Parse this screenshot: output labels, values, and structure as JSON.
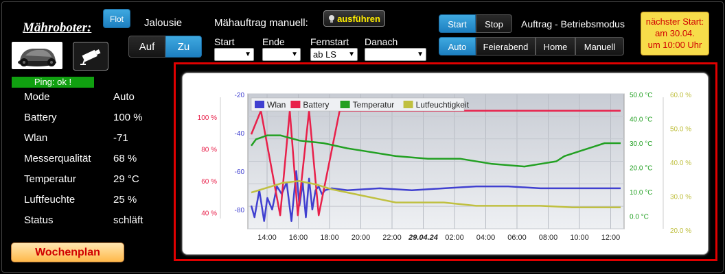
{
  "app": {
    "title": "Mähroboter:",
    "ping": "Ping: ok !",
    "wochenplan": "Wochenplan"
  },
  "status": [
    {
      "key": "Mode",
      "value": "Auto"
    },
    {
      "key": "Battery",
      "value": "100 %"
    },
    {
      "key": "Wlan",
      "value": "-71"
    },
    {
      "key": "Messerqualität",
      "value": "68 %"
    },
    {
      "key": "Temperatur",
      "value": "29 °C"
    },
    {
      "key": "Luftfeuchte",
      "value": "25 %"
    },
    {
      "key": "Status",
      "value": "schläft"
    }
  ],
  "jalousie": {
    "flot": "Flot",
    "label": "Jalousie",
    "auf": "Auf",
    "zu": "Zu"
  },
  "manual": {
    "label": "Mähauftrag manuell:",
    "execute": "ausführen",
    "fields": [
      {
        "label": "Start",
        "value": ""
      },
      {
        "label": "Ende",
        "value": ""
      },
      {
        "label": "Fernstart",
        "value": "ab LS"
      },
      {
        "label": "Danach",
        "value": ""
      }
    ]
  },
  "controls": {
    "start": "Start",
    "stop": "Stop",
    "auftrag": "Auftrag - Betriebsmodus",
    "modes": [
      "Auto",
      "Feierabend",
      "Home",
      "Manuell"
    ],
    "active_mode": "Auto"
  },
  "next_start": {
    "line1": "nächster Start:",
    "line2": "am 30.04.",
    "line3": "um 10:00 Uhr"
  },
  "colors": {
    "wlan": "#4040d0",
    "battery": "#e8204a",
    "temperatur": "#22a022",
    "lutf": "#c0c040",
    "accent": "#1d7fc0"
  },
  "chart_data": {
    "type": "line",
    "legend": [
      "Wlan",
      "Battery",
      "Temperatur",
      "Lutfeuchtigkeit"
    ],
    "legend_position": "top-left",
    "x_ticks": [
      "14:00",
      "16:00",
      "18:00",
      "20:00",
      "22:00",
      "29.04.24",
      "02:00",
      "04:00",
      "06:00",
      "08:00",
      "10:00",
      "12:00"
    ],
    "axes": {
      "wlan": {
        "ticks": [
          "-20",
          "-40",
          "-60",
          "-80"
        ],
        "range": [
          -90,
          -20
        ]
      },
      "battery": {
        "ticks": [
          "100 %",
          "80 %",
          "60 %",
          "40 %"
        ],
        "range": [
          30,
          110
        ]
      },
      "temperatur": {
        "ticks": [
          "50.0 °C",
          "40.0 °C",
          "30.0 °C",
          "20.0 °C",
          "10.0 °C",
          "0.0 °C"
        ],
        "range": [
          -2,
          50
        ]
      },
      "lutf": {
        "ticks": [
          "60.0 %",
          "50.0 %",
          "40.0 %",
          "30.0 %",
          "20.0 %"
        ],
        "range": [
          19,
          60
        ]
      }
    },
    "series": [
      {
        "name": "Wlan",
        "x": [
          0,
          0.2,
          0.5,
          0.8,
          1,
          1.3,
          1.6,
          1.9,
          2.2,
          2.5,
          2.8,
          3,
          3.2,
          3.4,
          3.6,
          3.8,
          4,
          4.2,
          4.4,
          4.6,
          5,
          6,
          8,
          10,
          12,
          14,
          16,
          18,
          20,
          22,
          23
        ],
        "y": [
          -78,
          -84,
          -70,
          -86,
          -74,
          -80,
          -68,
          -72,
          -66,
          -86,
          -60,
          -78,
          -66,
          -84,
          -64,
          -80,
          -70,
          -68,
          -72,
          -70,
          -69,
          -70,
          -69,
          -70,
          -69,
          -68,
          -68,
          -69,
          -69,
          -69,
          -69
        ]
      },
      {
        "name": "Battery",
        "x": [
          0,
          0.6,
          1.8,
          2.4,
          2.9,
          3.6,
          4.2,
          5.5,
          23
        ],
        "y": [
          86,
          100,
          38,
          100,
          38,
          100,
          38,
          100,
          100
        ]
      },
      {
        "name": "Temperatur",
        "x": [
          0,
          0.3,
          1,
          1.8,
          3,
          4.5,
          6,
          7,
          9,
          11,
          13,
          15,
          17,
          18,
          19,
          19.5,
          20.5,
          21.5,
          22,
          23
        ],
        "y": [
          30,
          32.5,
          34,
          34,
          32,
          31,
          29,
          28,
          26,
          25,
          25,
          23,
          22,
          23,
          24,
          26,
          28,
          30,
          31,
          31
        ]
      },
      {
        "name": "Lutfeuchtigkeit",
        "x": [
          0,
          1,
          2,
          3,
          4,
          5,
          6,
          7,
          8,
          9,
          10,
          12,
          14,
          16,
          18,
          20,
          21,
          22,
          23
        ],
        "y": [
          30,
          31.5,
          33,
          33.5,
          32.5,
          31,
          30,
          29,
          28,
          27,
          27,
          27,
          26,
          26,
          26,
          25.5,
          25.5,
          25.5,
          25.5
        ]
      }
    ]
  }
}
